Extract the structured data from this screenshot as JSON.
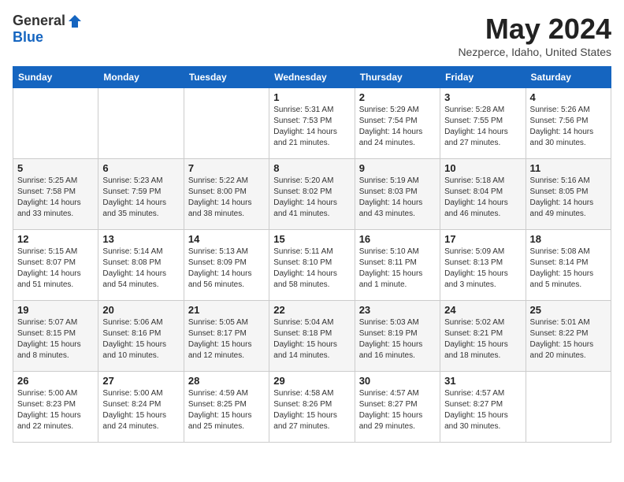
{
  "header": {
    "logo_general": "General",
    "logo_blue": "Blue",
    "month_title": "May 2024",
    "location": "Nezperce, Idaho, United States"
  },
  "days_of_week": [
    "Sunday",
    "Monday",
    "Tuesday",
    "Wednesday",
    "Thursday",
    "Friday",
    "Saturday"
  ],
  "weeks": [
    [
      {
        "day": "",
        "info": ""
      },
      {
        "day": "",
        "info": ""
      },
      {
        "day": "",
        "info": ""
      },
      {
        "day": "1",
        "info": "Sunrise: 5:31 AM\nSunset: 7:53 PM\nDaylight: 14 hours\nand 21 minutes."
      },
      {
        "day": "2",
        "info": "Sunrise: 5:29 AM\nSunset: 7:54 PM\nDaylight: 14 hours\nand 24 minutes."
      },
      {
        "day": "3",
        "info": "Sunrise: 5:28 AM\nSunset: 7:55 PM\nDaylight: 14 hours\nand 27 minutes."
      },
      {
        "day": "4",
        "info": "Sunrise: 5:26 AM\nSunset: 7:56 PM\nDaylight: 14 hours\nand 30 minutes."
      }
    ],
    [
      {
        "day": "5",
        "info": "Sunrise: 5:25 AM\nSunset: 7:58 PM\nDaylight: 14 hours\nand 33 minutes."
      },
      {
        "day": "6",
        "info": "Sunrise: 5:23 AM\nSunset: 7:59 PM\nDaylight: 14 hours\nand 35 minutes."
      },
      {
        "day": "7",
        "info": "Sunrise: 5:22 AM\nSunset: 8:00 PM\nDaylight: 14 hours\nand 38 minutes."
      },
      {
        "day": "8",
        "info": "Sunrise: 5:20 AM\nSunset: 8:02 PM\nDaylight: 14 hours\nand 41 minutes."
      },
      {
        "day": "9",
        "info": "Sunrise: 5:19 AM\nSunset: 8:03 PM\nDaylight: 14 hours\nand 43 minutes."
      },
      {
        "day": "10",
        "info": "Sunrise: 5:18 AM\nSunset: 8:04 PM\nDaylight: 14 hours\nand 46 minutes."
      },
      {
        "day": "11",
        "info": "Sunrise: 5:16 AM\nSunset: 8:05 PM\nDaylight: 14 hours\nand 49 minutes."
      }
    ],
    [
      {
        "day": "12",
        "info": "Sunrise: 5:15 AM\nSunset: 8:07 PM\nDaylight: 14 hours\nand 51 minutes."
      },
      {
        "day": "13",
        "info": "Sunrise: 5:14 AM\nSunset: 8:08 PM\nDaylight: 14 hours\nand 54 minutes."
      },
      {
        "day": "14",
        "info": "Sunrise: 5:13 AM\nSunset: 8:09 PM\nDaylight: 14 hours\nand 56 minutes."
      },
      {
        "day": "15",
        "info": "Sunrise: 5:11 AM\nSunset: 8:10 PM\nDaylight: 14 hours\nand 58 minutes."
      },
      {
        "day": "16",
        "info": "Sunrise: 5:10 AM\nSunset: 8:11 PM\nDaylight: 15 hours\nand 1 minute."
      },
      {
        "day": "17",
        "info": "Sunrise: 5:09 AM\nSunset: 8:13 PM\nDaylight: 15 hours\nand 3 minutes."
      },
      {
        "day": "18",
        "info": "Sunrise: 5:08 AM\nSunset: 8:14 PM\nDaylight: 15 hours\nand 5 minutes."
      }
    ],
    [
      {
        "day": "19",
        "info": "Sunrise: 5:07 AM\nSunset: 8:15 PM\nDaylight: 15 hours\nand 8 minutes."
      },
      {
        "day": "20",
        "info": "Sunrise: 5:06 AM\nSunset: 8:16 PM\nDaylight: 15 hours\nand 10 minutes."
      },
      {
        "day": "21",
        "info": "Sunrise: 5:05 AM\nSunset: 8:17 PM\nDaylight: 15 hours\nand 12 minutes."
      },
      {
        "day": "22",
        "info": "Sunrise: 5:04 AM\nSunset: 8:18 PM\nDaylight: 15 hours\nand 14 minutes."
      },
      {
        "day": "23",
        "info": "Sunrise: 5:03 AM\nSunset: 8:19 PM\nDaylight: 15 hours\nand 16 minutes."
      },
      {
        "day": "24",
        "info": "Sunrise: 5:02 AM\nSunset: 8:21 PM\nDaylight: 15 hours\nand 18 minutes."
      },
      {
        "day": "25",
        "info": "Sunrise: 5:01 AM\nSunset: 8:22 PM\nDaylight: 15 hours\nand 20 minutes."
      }
    ],
    [
      {
        "day": "26",
        "info": "Sunrise: 5:00 AM\nSunset: 8:23 PM\nDaylight: 15 hours\nand 22 minutes."
      },
      {
        "day": "27",
        "info": "Sunrise: 5:00 AM\nSunset: 8:24 PM\nDaylight: 15 hours\nand 24 minutes."
      },
      {
        "day": "28",
        "info": "Sunrise: 4:59 AM\nSunset: 8:25 PM\nDaylight: 15 hours\nand 25 minutes."
      },
      {
        "day": "29",
        "info": "Sunrise: 4:58 AM\nSunset: 8:26 PM\nDaylight: 15 hours\nand 27 minutes."
      },
      {
        "day": "30",
        "info": "Sunrise: 4:57 AM\nSunset: 8:27 PM\nDaylight: 15 hours\nand 29 minutes."
      },
      {
        "day": "31",
        "info": "Sunrise: 4:57 AM\nSunset: 8:27 PM\nDaylight: 15 hours\nand 30 minutes."
      },
      {
        "day": "",
        "info": ""
      }
    ]
  ]
}
